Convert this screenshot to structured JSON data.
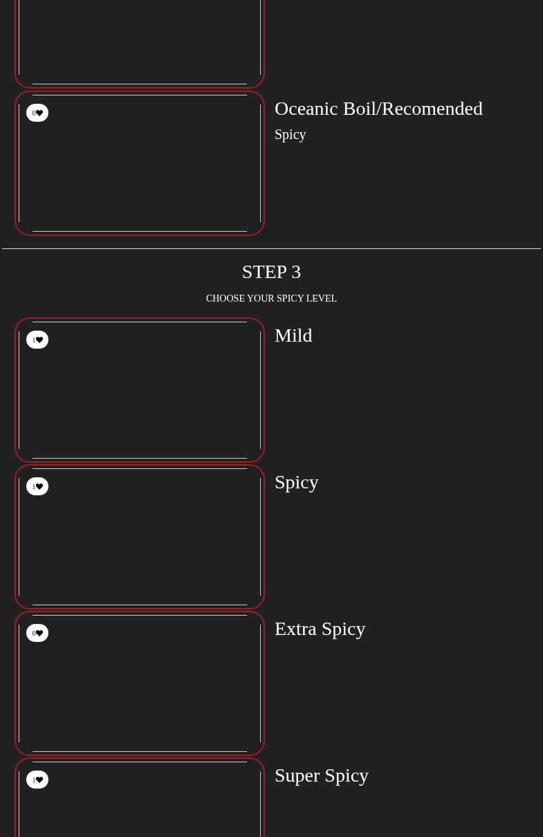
{
  "step2": {
    "options": [
      {
        "cropped": true
      },
      {
        "likes": "0",
        "title": "Oceanic Boil/Recomended",
        "subtitle": "Spicy"
      }
    ]
  },
  "step3": {
    "heading": "STEP 3",
    "subheading": "CHOOSE YOUR SPICY LEVEL",
    "options": [
      {
        "likes": "1",
        "title": "Mild"
      },
      {
        "likes": "1",
        "title": "Spicy"
      },
      {
        "likes": "0",
        "title": "Extra Spicy"
      },
      {
        "likes": "1",
        "title": "Super Spicy"
      }
    ]
  }
}
